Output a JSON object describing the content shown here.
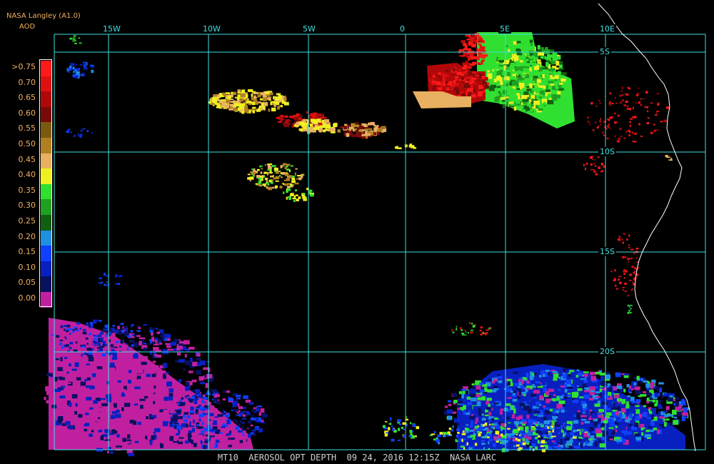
{
  "header": {
    "source": "NASA Langley (A1.0)",
    "variable": "AOD"
  },
  "legend": {
    "items": [
      {
        "label": ">0.75",
        "color": "#ff1a1a"
      },
      {
        "label": "0.70",
        "color": "#e01010"
      },
      {
        "label": "0.65",
        "color": "#b00808"
      },
      {
        "label": "0.60",
        "color": "#7a0a0a"
      },
      {
        "label": "0.55",
        "color": "#7a5a10"
      },
      {
        "label": "0.50",
        "color": "#b08020"
      },
      {
        "label": "0.45",
        "color": "#e8b060"
      },
      {
        "label": "0.40",
        "color": "#f0f020"
      },
      {
        "label": "0.35",
        "color": "#30e030"
      },
      {
        "label": "0.30",
        "color": "#20a020"
      },
      {
        "label": "0.25",
        "color": "#106010"
      },
      {
        "label": "0.20",
        "color": "#2090e0"
      },
      {
        "label": "0.15",
        "color": "#1040ff"
      },
      {
        "label": "0.10",
        "color": "#0820c0"
      },
      {
        "label": "0.05",
        "color": "#081060"
      },
      {
        "label": "0.00",
        "color": "#c020a0"
      }
    ]
  },
  "grid": {
    "longitudes": [
      "15W",
      "10W",
      "5W",
      "0",
      "5E",
      "10E"
    ],
    "latitudes": [
      "5S",
      "10S",
      "15S",
      "20S"
    ],
    "color": "#40e0e0"
  },
  "footer": {
    "product": "MT10",
    "title": "AEROSOL OPT DEPTH",
    "datetime": "09 24, 2016 12:15Z",
    "org": "NASA LARC"
  }
}
